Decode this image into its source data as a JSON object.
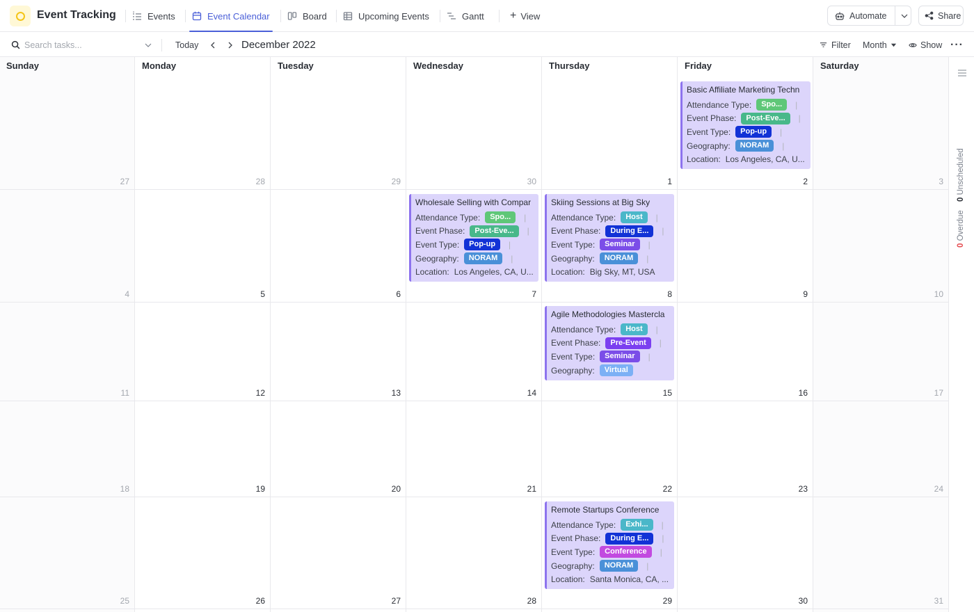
{
  "header": {
    "space_title": "Event Tracking",
    "tabs": [
      {
        "label": "Events",
        "icon": "list-icon",
        "active": false
      },
      {
        "label": "Event Calendar",
        "icon": "calendar-icon",
        "active": true
      },
      {
        "label": "Board",
        "icon": "board-icon",
        "active": false
      },
      {
        "label": "Upcoming Events",
        "icon": "table-icon",
        "active": false
      },
      {
        "label": "Gantt",
        "icon": "gantt-icon",
        "active": false
      }
    ],
    "add_view_label": "View",
    "automate_label": "Automate",
    "share_label": "Share"
  },
  "toolbar": {
    "search_placeholder": "Search tasks...",
    "today_label": "Today",
    "month_label": "December 2022",
    "filter_label": "Filter",
    "month_dropdown_label": "Month",
    "show_label": "Show"
  },
  "calendar": {
    "weekdays": [
      "Sunday",
      "Monday",
      "Tuesday",
      "Wednesday",
      "Thursday",
      "Friday",
      "Saturday"
    ],
    "weeks": [
      [
        "27",
        "28",
        "29",
        "30",
        "1",
        "2",
        "3"
      ],
      [
        "4",
        "5",
        "6",
        "7",
        "8",
        "9",
        "10"
      ],
      [
        "11",
        "12",
        "13",
        "14",
        "15",
        "16",
        "17"
      ],
      [
        "18",
        "19",
        "20",
        "21",
        "22",
        "23",
        "24"
      ],
      [
        "25",
        "26",
        "27",
        "28",
        "29",
        "30",
        "31"
      ]
    ]
  },
  "field_labels": {
    "attendance": "Attendance Type:",
    "phase": "Event Phase:",
    "type": "Event Type:",
    "geo": "Geography:",
    "location": "Location:"
  },
  "events": [
    {
      "title": "Basic Affiliate Marketing Techn",
      "attendance": {
        "text": "Spo...",
        "color": "#5fc778"
      },
      "phase": {
        "text": "Post-Eve...",
        "color": "#48b88a"
      },
      "type": {
        "text": "Pop-up",
        "color": "#1232d6"
      },
      "geo": {
        "text": "NORAM",
        "color": "#4a90d8"
      },
      "location": "Los Angeles, CA, U..."
    },
    {
      "title": "Wholesale Selling with Compar",
      "attendance": {
        "text": "Spo...",
        "color": "#5fc778"
      },
      "phase": {
        "text": "Post-Eve...",
        "color": "#48b88a"
      },
      "type": {
        "text": "Pop-up",
        "color": "#1232d6"
      },
      "geo": {
        "text": "NORAM",
        "color": "#4a90d8"
      },
      "location": "Los Angeles, CA, U..."
    },
    {
      "title": "Skiing Sessions at Big Sky",
      "attendance": {
        "text": "Host",
        "color": "#4ab7c9"
      },
      "phase": {
        "text": "During E...",
        "color": "#1232d6"
      },
      "type": {
        "text": "Seminar",
        "color": "#7b4de8"
      },
      "geo": {
        "text": "NORAM",
        "color": "#4a90d8"
      },
      "location": "Big Sky, MT, USA"
    },
    {
      "title": "Agile Methodologies Mastercla",
      "attendance": {
        "text": "Host",
        "color": "#4ab7c9"
      },
      "phase": {
        "text": "Pre-Event",
        "color": "#7b3ff0"
      },
      "type": {
        "text": "Seminar",
        "color": "#7b4de8"
      },
      "geo": {
        "text": "Virtual",
        "color": "#7cb0f5"
      }
    },
    {
      "title": "Remote Startups Conference",
      "attendance": {
        "text": "Exhi...",
        "color": "#4ab7c9"
      },
      "phase": {
        "text": "During E...",
        "color": "#1232d6"
      },
      "type": {
        "text": "Conference",
        "color": "#c24ae0"
      },
      "geo": {
        "text": "NORAM",
        "color": "#4a90d8"
      },
      "location": "Santa Monica, CA, ..."
    }
  ],
  "rail": {
    "unscheduled_count": "0",
    "unscheduled_label": "Unscheduled",
    "overdue_count": "0",
    "overdue_label": "Overdue"
  },
  "colors": {
    "accent": "#4a5fd8",
    "card_bg": "#dcd5fb",
    "card_border": "#8d73ee"
  }
}
